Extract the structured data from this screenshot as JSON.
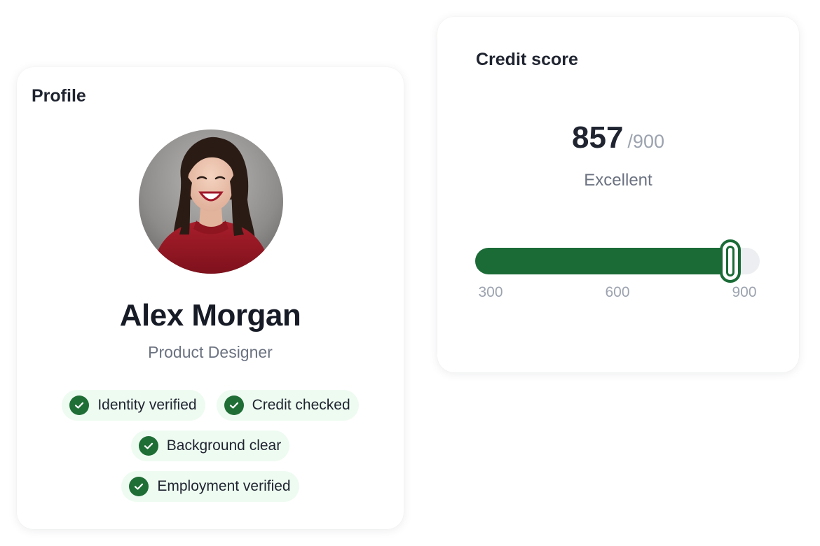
{
  "profile": {
    "title": "Profile",
    "name": "Alex Morgan",
    "role": "Product Designer",
    "avatar_icon": "profile-photo",
    "badges": [
      {
        "label": "Identity verified",
        "icon": "check-circle-icon"
      },
      {
        "label": "Credit checked",
        "icon": "check-circle-icon"
      },
      {
        "label": "Background clear",
        "icon": "check-circle-icon"
      },
      {
        "label": "Employment verified",
        "icon": "check-circle-icon"
      }
    ]
  },
  "credit_score": {
    "title": "Credit score",
    "value": "857",
    "max_label": "/900",
    "rating": "Excellent",
    "scale": {
      "min": 300,
      "max": 900,
      "current": 857,
      "labels": [
        "300",
        "600",
        "900"
      ]
    }
  },
  "colors": {
    "accent": "#1b6b37",
    "badge_bg": "#eefbf1",
    "text_primary": "#1f2430",
    "text_muted": "#6b7280",
    "text_light": "#9ca3af"
  }
}
